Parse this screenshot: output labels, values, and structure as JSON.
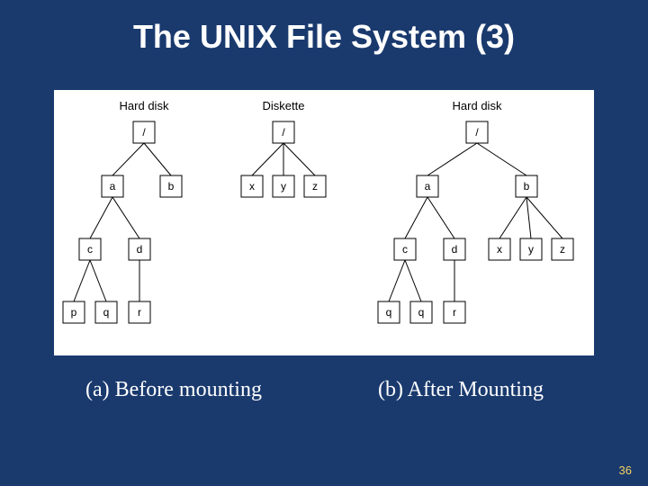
{
  "title": "The UNIX File System (3)",
  "caption_a": "(a) Before mounting",
  "caption_b": "(b) After Mounting",
  "page_number": "36",
  "headers": {
    "hd1": "Hard disk",
    "dk": "Diskette",
    "hd2": "Hard disk"
  },
  "tree_before_hard": {
    "root": "/",
    "a": "a",
    "b": "b",
    "c": "c",
    "d": "d",
    "p": "p",
    "q": "q",
    "r": "r"
  },
  "tree_diskette": {
    "root": "/",
    "x": "x",
    "y": "y",
    "z": "z"
  },
  "tree_after": {
    "root": "/",
    "a": "a",
    "b": "b",
    "c": "c",
    "d": "d",
    "q1": "q",
    "q2": "q",
    "r": "r",
    "x": "x",
    "y": "y",
    "z": "z"
  }
}
